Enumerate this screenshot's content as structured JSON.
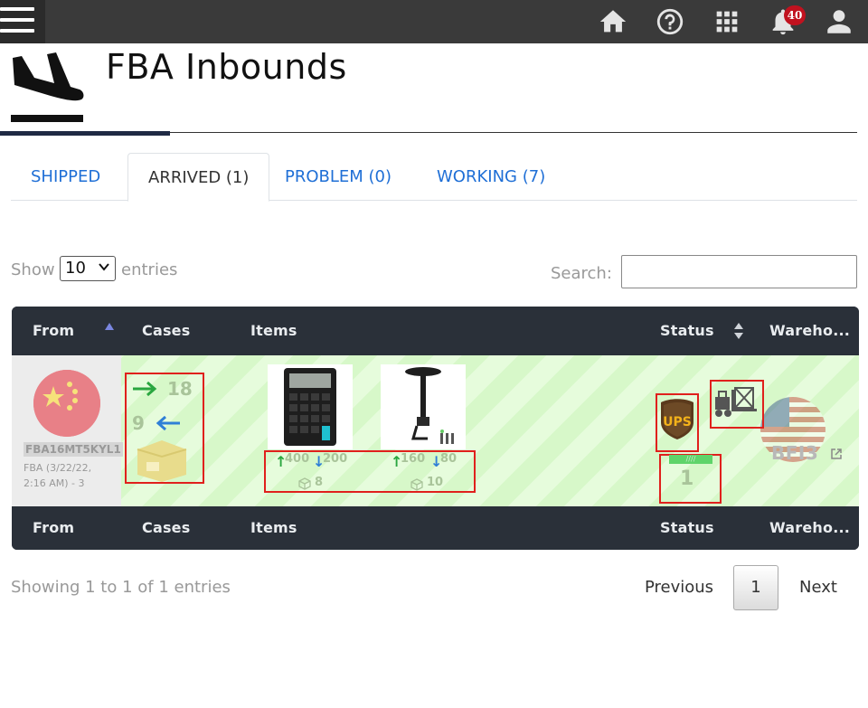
{
  "topbar": {
    "menu_icon": "hamburger-icon",
    "icons": [
      "home-icon",
      "help-icon",
      "apps-grid-icon",
      "bell-icon",
      "user-icon"
    ],
    "notifications_count": "40"
  },
  "header": {
    "title": "FBA Inbounds",
    "icon": "plane-arrival-icon"
  },
  "tabs": [
    {
      "label": "SHIPPED",
      "active": false
    },
    {
      "label": "ARRIVED (1)",
      "active": true
    },
    {
      "label": "PROBLEM (0)",
      "active": false
    },
    {
      "label": "WORKING (7)",
      "active": false
    }
  ],
  "controls": {
    "show_label": "Show",
    "entries_value": "10",
    "entries_label": "entries",
    "search_label": "Search:",
    "search_value": ""
  },
  "table": {
    "columns": [
      "From",
      "Cases",
      "Items",
      "Status",
      "Wareho..."
    ],
    "footer_columns": [
      "From",
      "Cases",
      "Items",
      "Status",
      "Wareho..."
    ],
    "rows": [
      {
        "from_flag": "china-flag-icon",
        "shipment_id": "FBA16MT5KYL1",
        "meta_line1": "FBA (3/22/22,",
        "meta_line2": "2:16 AM) - 3",
        "cases_sent": "18",
        "cases_received": "9",
        "items": [
          {
            "image": "calculator-image",
            "sent": "400",
            "received": "200",
            "cases": "8"
          },
          {
            "image": "ceiling-mount-image",
            "sent": "160",
            "received": "80",
            "cases": "10"
          }
        ],
        "carrier": "UPS",
        "status_count": "1",
        "status_bar_text": "////",
        "warehouse_flag": "usa-flag-icon",
        "warehouse_code": "BFI3"
      }
    ]
  },
  "footer": {
    "info": "Showing 1 to 1 of 1 entries",
    "previous": "Previous",
    "current_page": "1",
    "next": "Next"
  },
  "colors": {
    "topbar": "#3a3a3a",
    "table_header": "#2a3039",
    "row_bg": "#d7f8c9",
    "tab_link": "#1f6fd6",
    "annotation_red": "#e0201c",
    "badge": "#c1121f"
  }
}
